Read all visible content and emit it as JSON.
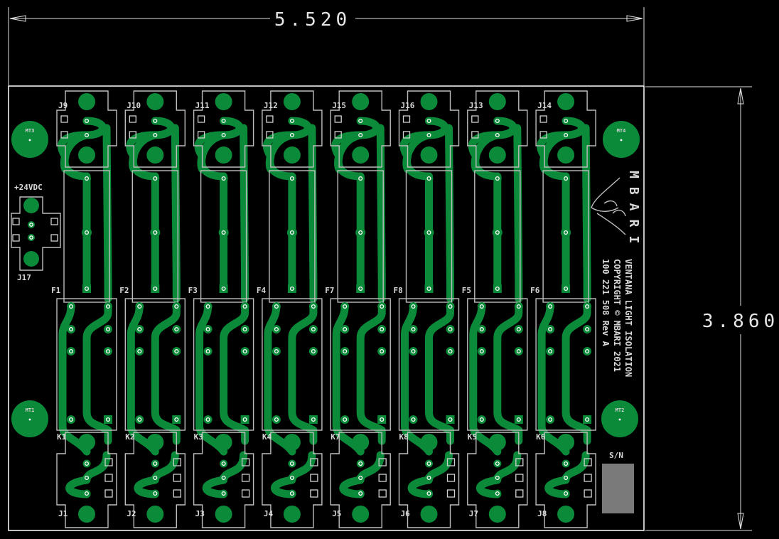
{
  "dimensions": {
    "width": "5.520",
    "height": "3.860"
  },
  "colors": {
    "copper": "#0b8a3a",
    "board_outline": "#ffffff",
    "silkscreen": "#bdbdbd",
    "background": "#000000",
    "sn_box": "#7a7a7a"
  },
  "power_connector": {
    "label": "+24VDC",
    "designator": "J17"
  },
  "channels": [
    {
      "top_connector": "J9",
      "fuse": "F1",
      "relay": "K1",
      "bottom_connector": "J1"
    },
    {
      "top_connector": "J10",
      "fuse": "F2",
      "relay": "K2",
      "bottom_connector": "J2"
    },
    {
      "top_connector": "J11",
      "fuse": "F3",
      "relay": "K3",
      "bottom_connector": "J3"
    },
    {
      "top_connector": "J12",
      "fuse": "F4",
      "relay": "K4",
      "bottom_connector": "J4"
    },
    {
      "top_connector": "J15",
      "fuse": "F7",
      "relay": "K7",
      "bottom_connector": "J5"
    },
    {
      "top_connector": "J16",
      "fuse": "F8",
      "relay": "K8",
      "bottom_connector": "J6"
    },
    {
      "top_connector": "J13",
      "fuse": "F5",
      "relay": "K5",
      "bottom_connector": "J7"
    },
    {
      "top_connector": "J14",
      "fuse": "F6",
      "relay": "K6",
      "bottom_connector": "J8"
    }
  ],
  "mounting_holes": [
    "MT3",
    "MT4",
    "MT1",
    "MT2"
  ],
  "logo": {
    "text": "MBARI"
  },
  "board_info": {
    "line1": "VENTANA LIGHT ISOLATION",
    "line2": "COPYRIGHT © MBARI 2021",
    "line3": "100 221 508  Rev A"
  },
  "serial_label": "S/N"
}
